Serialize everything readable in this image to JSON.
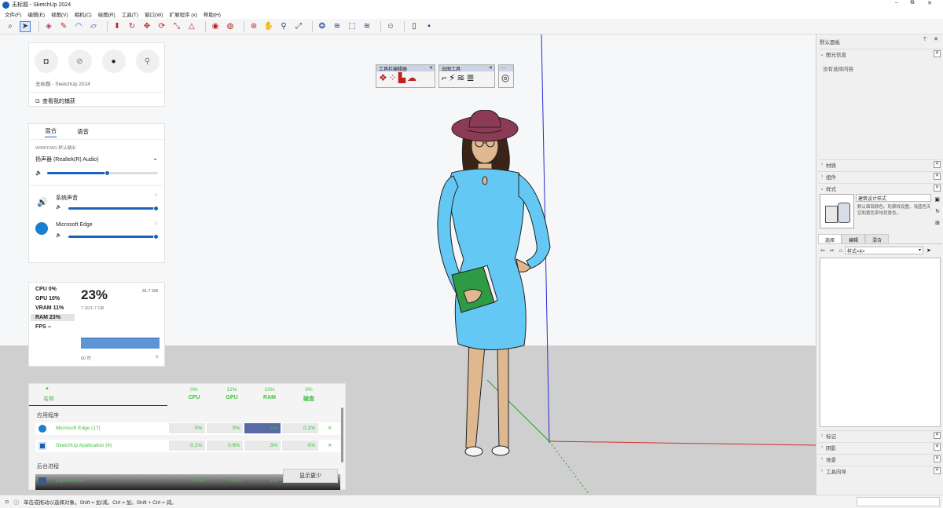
{
  "window": {
    "title": "无标题 - SketchUp 2024",
    "controls": [
      "–",
      "⧉",
      "✕"
    ]
  },
  "menu": [
    "文件(F)",
    "编辑(E)",
    "视图(V)",
    "相机(C)",
    "绘图(R)",
    "工具(T)",
    "窗口(W)",
    "扩展程序 (x)",
    "帮助(H)"
  ],
  "toolbar_icons": [
    "search-icon",
    "select-icon",
    "eraser-icon",
    "pencil-icon",
    "arc-icon",
    "rectangle-icon",
    "push-pull-icon",
    "follow-me-icon",
    "move-icon",
    "rotate-icon",
    "scale-icon",
    "offset-icon",
    "tape-measure-icon",
    "paint-bucket-icon",
    "orbit-icon",
    "pan-icon",
    "zoom-icon",
    "zoom-extents-icon",
    "warehouse-icon",
    "extension-icon",
    "share-icon",
    "layout-icon",
    "profile-icon",
    "new-file-icon",
    "account-icon"
  ],
  "capture_widget": {
    "buttons": [
      "camera-icon",
      "no-record-icon",
      "record-icon",
      "mic-off-icon"
    ],
    "app_label": "无标题 - SketchUp 2024",
    "link": "查看我的捕获"
  },
  "audio_widget": {
    "tabs": [
      "混合",
      "语音"
    ],
    "section_label": "WINDOWS 默认输出",
    "device": "扬声器 (Realtek(R) Audio)",
    "master_level": 0.55,
    "apps": [
      {
        "name": "系统声音",
        "level": 1.0
      },
      {
        "name": "Microsoft Edge",
        "level": 1.0
      }
    ]
  },
  "perf_widget": {
    "rows": [
      {
        "label": "CPU",
        "value": "0%"
      },
      {
        "label": "GPU",
        "value": "10%"
      },
      {
        "label": "VRAM",
        "value": "11%"
      },
      {
        "label": "RAM",
        "value": "23%"
      },
      {
        "label": "FPS",
        "value": "--"
      }
    ],
    "big_value": "23%",
    "total": "31.7 GB",
    "used": "7.3/31.7 GB",
    "x_left": "60 秒",
    "x_right": "0"
  },
  "resource_widget": {
    "name_col": "名称",
    "columns": [
      {
        "pct": "0%",
        "label": "CPU"
      },
      {
        "pct": "12%",
        "label": "GPU"
      },
      {
        "pct": "23%",
        "label": "RAM"
      },
      {
        "pct": "0%",
        "label": "磁盘"
      }
    ],
    "group_apps": "应用程序",
    "apps": [
      {
        "name": "Microsoft Edge (17)",
        "cpu": "0%",
        "gpu": "0%",
        "ram": "5%",
        "disk": "0.2%"
      },
      {
        "name": "SketchUp Application (4)",
        "cpu": "0.1%",
        "gpu": "0.9%",
        "ram": "3%",
        "disk": "0%"
      }
    ],
    "group_bg": "后台进程",
    "bg_apps": [
      {
        "name": "explorer.exe",
        "cpu": "0.7%",
        "gpu": "0.2%",
        "ram": "1%"
      }
    ],
    "show_more": "显示更少"
  },
  "floating_toolbars": [
    {
      "title": "工具栏编辑器"
    },
    {
      "title": "出图工具"
    },
    {
      "title": "…"
    }
  ],
  "tray": {
    "title": "默认面板",
    "entity_info": {
      "label": "图元信息",
      "body": "没有选择内容"
    },
    "collapsed_top": [
      "材质",
      "组件"
    ],
    "styles": {
      "label": "样式",
      "style_name": "建筑设计样式",
      "style_desc": "默认面部颜色。轮廓线设置。浅蓝色天空和黄色草地背景色。",
      "tabs": [
        "选择",
        "编辑",
        "混合"
      ],
      "dropdown": "样式<4>"
    },
    "collapsed_bottom": [
      "标记",
      "阴影",
      "场景",
      "工具向导"
    ]
  },
  "status": {
    "text": "单击或拖动以选择对象。Shift = 加/减。Ctrl = 加。Shift + Ctrl = 减。"
  },
  "colors": {
    "dress": "#64c8f5",
    "hat": "#8c3a55",
    "book": "#2f9a44",
    "axis_blue": "#2b2bd0",
    "axis_red": "#d03030",
    "axis_green": "#2aa02a",
    "widget_green": "#3bc33b",
    "accent": "#1a63b8"
  }
}
